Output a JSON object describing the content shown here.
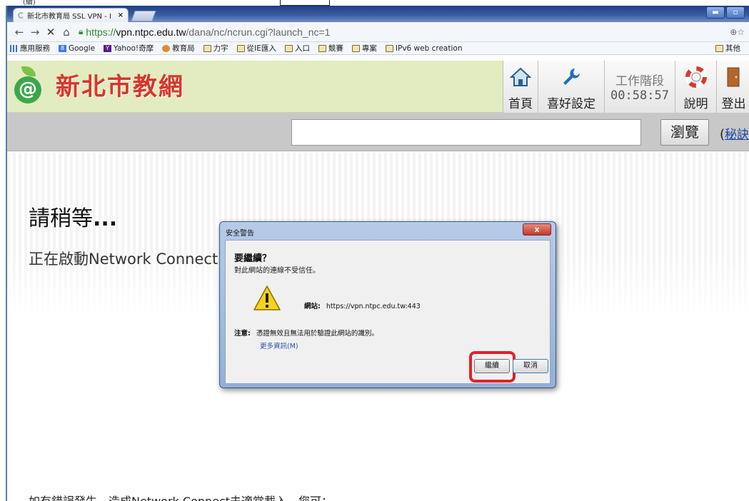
{
  "top_fragment": "(續)",
  "browser": {
    "tab_title": "新北市教育局 SSL VPN - I",
    "tab_close": "×",
    "window_buttons": [
      "▬",
      "▫"
    ],
    "url": {
      "scheme": "https://",
      "host": "vpn.ntpc.edu.tw",
      "path": "/dana/nc/ncrun.cgi?launch_nc=1"
    },
    "url_right": "⊕☆",
    "bookmarks": [
      {
        "icon": "apps-icon",
        "label": "應用服務"
      },
      {
        "icon": "google-icon",
        "label": "Google"
      },
      {
        "icon": "yahoo-icon",
        "label": "Yahoo!奇摩"
      },
      {
        "icon": "edu-icon",
        "label": "教育局"
      },
      {
        "icon": "folder-icon",
        "label": "力宇"
      },
      {
        "icon": "folder-icon",
        "label": "從IE匯入"
      },
      {
        "icon": "folder-icon",
        "label": "入口"
      },
      {
        "icon": "folder-icon",
        "label": "競賽"
      },
      {
        "icon": "folder-icon",
        "label": "專案"
      },
      {
        "icon": "folder-icon",
        "label": "IPv6 web creation"
      }
    ],
    "bookmarks_other": "其他"
  },
  "site": {
    "logo_text": "新北市教網",
    "nav": {
      "home": "首頁",
      "preferences": "喜好設定",
      "session_label": "工作階段",
      "session_time": "00:58:57",
      "help": "說明",
      "logout": "登出"
    },
    "browse_button": "瀏覽",
    "secret_paren": "(",
    "secret_link": "秘訣"
  },
  "content": {
    "wait_title": "請稍等",
    "wait_dots": "...",
    "starting": "正在啟動Network Connect",
    "error_note": "如有錯誤發生，造成Network Connect未適當載入，您可："
  },
  "dialog": {
    "title": "安全警告",
    "close": "x",
    "question": "要繼續？",
    "untrusted": "對此網站的連線不受信任。",
    "site_label": "網站:",
    "site_value": "https://vpn.ntpc.edu.tw:443",
    "note_label": "注意:",
    "note_text": "憑證無效且無法用於驗證此網站的識別。",
    "more_info": "更多資訊(M)",
    "continue": "繼續",
    "cancel": "取消"
  },
  "colors": {
    "highlight": "#e4202a",
    "logo_red": "#d7372b",
    "header_green": "#e2ecc0"
  }
}
